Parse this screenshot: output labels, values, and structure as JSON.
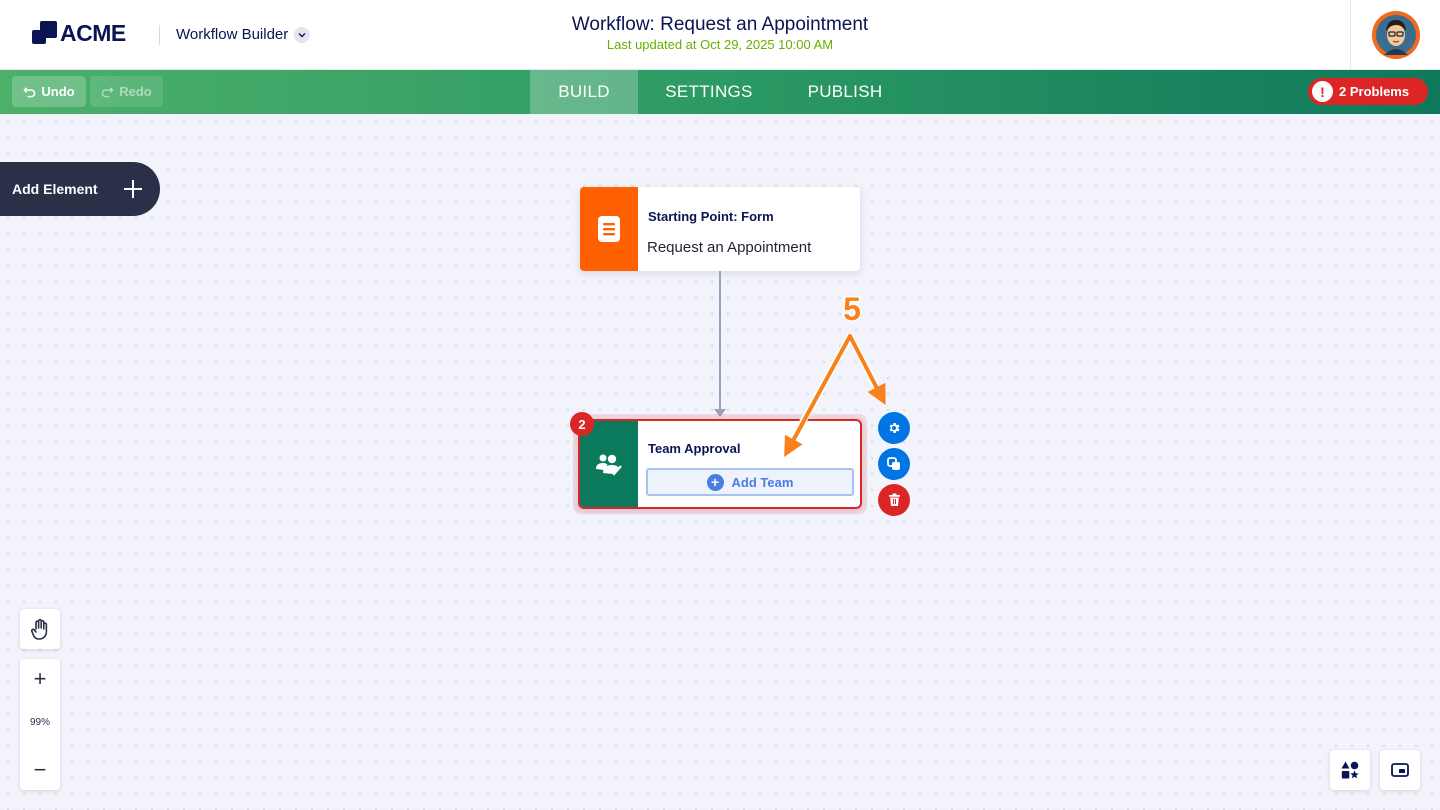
{
  "header": {
    "brand": "ACME",
    "app_name": "Workflow Builder",
    "workflow_title": "Workflow: Request an Appointment",
    "last_updated": "Last updated at Oct 29, 2025 10:00 AM"
  },
  "toolbar": {
    "undo_label": "Undo",
    "redo_label": "Redo",
    "tabs": [
      {
        "label": "BUILD",
        "active": true
      },
      {
        "label": "SETTINGS",
        "active": false
      },
      {
        "label": "PUBLISH",
        "active": false
      }
    ],
    "problems_label": "2 Problems",
    "problems_icon": "!"
  },
  "canvas": {
    "add_element_label": "Add Element",
    "start_node": {
      "title": "Starting Point: Form",
      "subtitle": "Request an Appointment",
      "color": "#ff6100"
    },
    "team_node": {
      "title": "Team Approval",
      "add_team_label": "Add Team",
      "error_count": "2",
      "color": "#0b7a5c"
    },
    "annotation_number": "5"
  },
  "zoom": {
    "level": "99%",
    "zoom_in_label": "+",
    "zoom_out_label": "−"
  },
  "colors": {
    "accent": "#0075e3",
    "error": "#dc2626",
    "annotation": "#f7821b",
    "toolbar_start": "#4cb06a",
    "toolbar_end": "#10785a"
  }
}
